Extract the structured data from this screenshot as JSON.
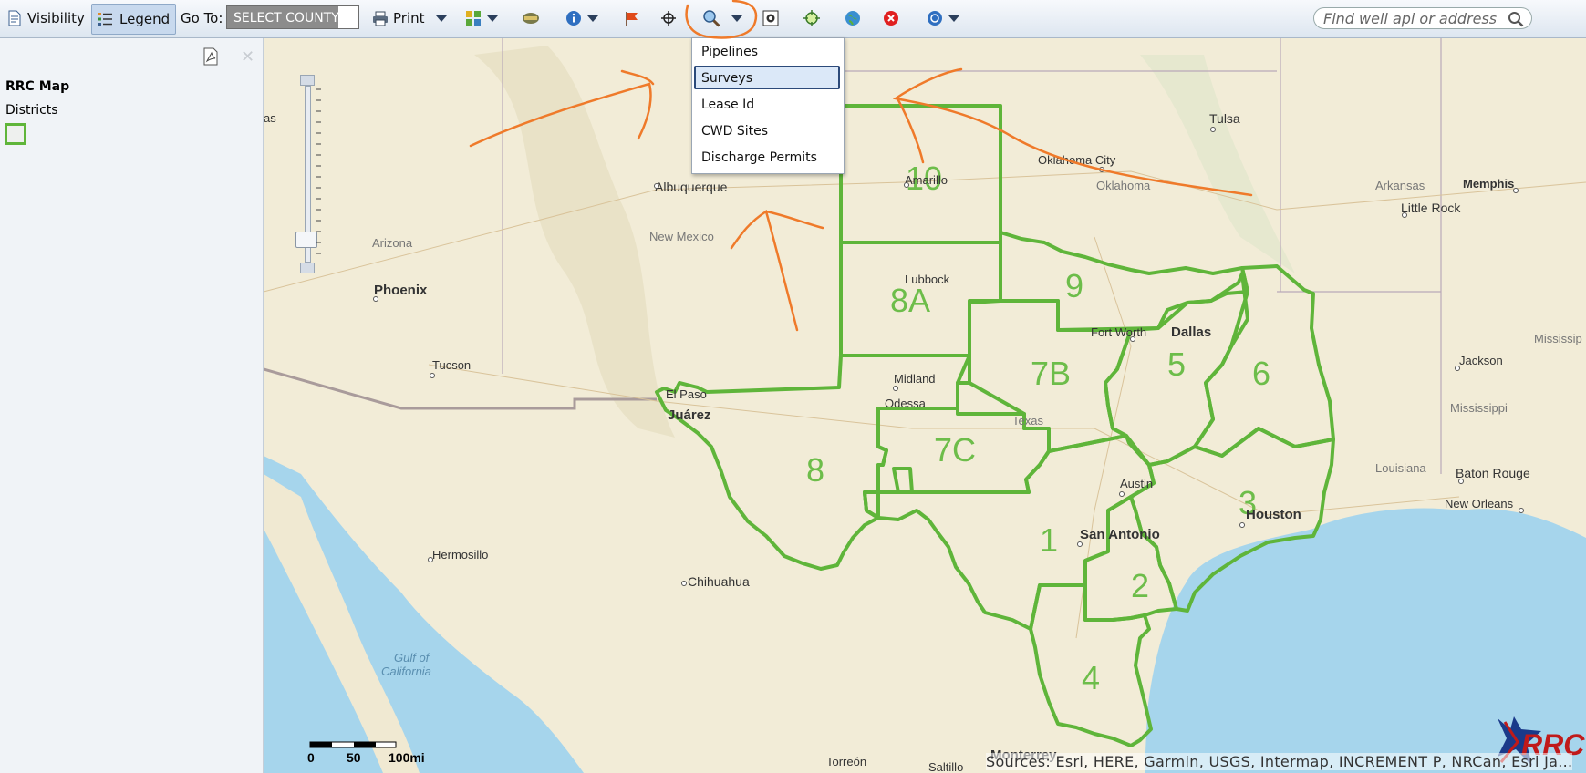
{
  "toolbar": {
    "visibility_label": "Visibility",
    "legend_label": "Legend",
    "goto_label": "Go To:",
    "county_select_value": "SELECT COUNTY",
    "print_label": "Print",
    "search_placeholder": "Find well api or address"
  },
  "dropdown": {
    "items": [
      "Pipelines",
      "Surveys",
      "Lease Id",
      "CWD Sites",
      "Discharge Permits"
    ],
    "selected": "Surveys"
  },
  "panel": {
    "title": "RRC Map",
    "layer_label": "Districts"
  },
  "map": {
    "districts": [
      "10",
      "8A",
      "9",
      "7B",
      "5",
      "6",
      "7C",
      "8",
      "1",
      "3",
      "2",
      "4"
    ],
    "places": {
      "tulsa": "Tulsa",
      "oklahoma_city": "Oklahoma City",
      "oklahoma": "Oklahoma",
      "arkansas": "Arkansas",
      "memphis": "Memphis",
      "little_rock": "Little Rock",
      "albuquerque": "Albuquerque",
      "amarillo": "Amarillo",
      "new_mexico": "New Mexico",
      "arizona": "Arizona",
      "phoenix": "Phoenix",
      "lubbock": "Lubbock",
      "fort_worth": "Fort Worth",
      "dallas": "Dallas",
      "mississippi_top": "Mississip",
      "jackson": "Jackson",
      "mississippi": "Mississippi",
      "tucson": "Tucson",
      "el_paso": "El Paso",
      "juarez": "Juárez",
      "midland": "Midland",
      "odessa": "Odessa",
      "texas": "Texas",
      "louisiana": "Louisiana",
      "baton_rouge": "Baton Rouge",
      "new_orleans": "New Orleans",
      "austin": "Austin",
      "houston": "Houston",
      "san_antonio": "San Antonio",
      "hermosillo": "Hermosillo",
      "chihuahua": "Chihuahua",
      "gulf": "Gulf of",
      "california": "California",
      "torreon": "Torreón",
      "saltillo": "Saltillo",
      "monterrey": "Monterrey",
      "edge_as": "as"
    },
    "scale_labels": [
      "0",
      "50",
      "100mi"
    ],
    "attribution": "Sources: Esri, HERE, Garmin, USGS, Intermap, INCREMENT P, NRCan, Esri Ja...",
    "logo_text": "RRC"
  },
  "colors": {
    "district_line": "#5fb53a",
    "annotation": "#ef7a2a",
    "land": "#f2ecd7",
    "water": "#a6d5ec",
    "toolbar_accent": "#2b3f5c"
  }
}
